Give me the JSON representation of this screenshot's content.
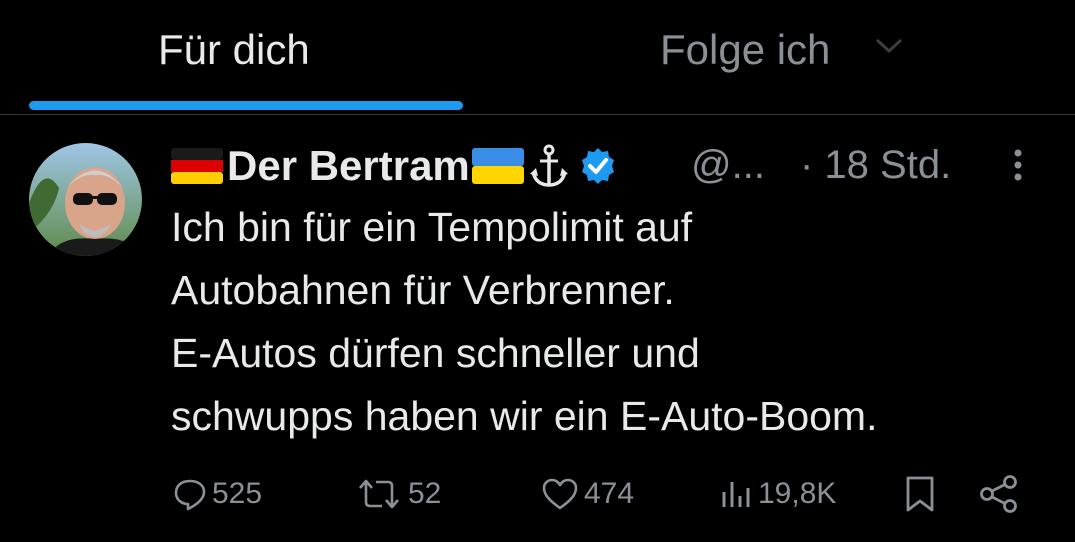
{
  "tabs": {
    "for_you": "Für dich",
    "following": "Folge ich"
  },
  "tweet": {
    "author_name": "Der Bertram",
    "handle": "@...",
    "time": "· 18 Std.",
    "text_lines": [
      "Ich bin für ein Tempolimit auf",
      "Autobahnen für Verbrenner.",
      "E-Autos dürfen schneller und",
      "schwupps haben wir ein E-Auto-Boom."
    ],
    "emojis": [
      "german-flag",
      "ukraine-flag",
      "anchor"
    ],
    "verified": true
  },
  "actions": {
    "replies": "525",
    "retweets": "52",
    "likes": "474",
    "views": "19,8K"
  },
  "colors": {
    "background": "#000000",
    "text": "#e7e9ea",
    "muted": "#8b9097",
    "accent": "#1d9bf0"
  }
}
